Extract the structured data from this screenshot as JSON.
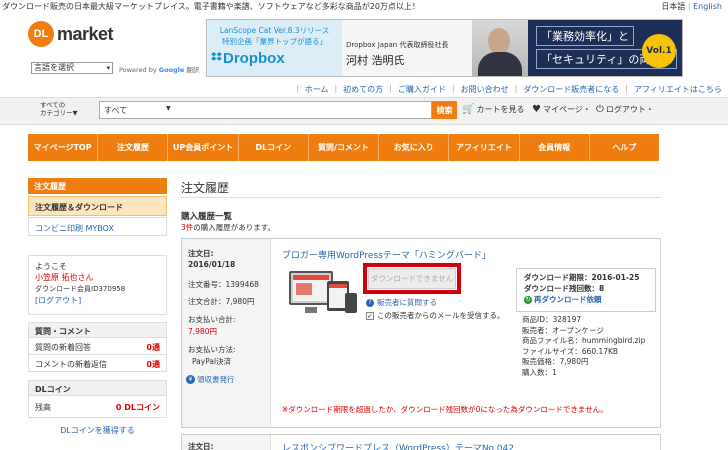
{
  "header": {
    "tagline": "ダウンロード販売の日本最大級マーケットプレイス。電子書籍や楽譜、ソフトウェアなど多彩な商品が20万点以上！",
    "lang_ja": "日本語",
    "lang_sep": "|",
    "lang_en": "English",
    "logo_mark": "DL",
    "logo_text": "market",
    "lang_select": "言語を選択",
    "powered_by": "Powered by",
    "google": "Google",
    "translate": "翻訳"
  },
  "banner": {
    "line1": "LanScope Cat Ver.8.3リリース",
    "line2": "特別企画「業界トップが語る」",
    "brand": "Dropbox",
    "company": "Dropbox Japan 代表取締役社長",
    "person": "河村 浩明氏",
    "headline1": "「業務効率化」と",
    "headline2": "「セキュリティ」の両立へ",
    "vol": "Vol.1"
  },
  "util_links": [
    "ホーム",
    "初めての方",
    "ご購入ガイド",
    "お問い合わせ",
    "ダウンロード販売者になる",
    "アフィリエイトはこちら"
  ],
  "search": {
    "category_label": "すべての\nカテゴリー▼",
    "value": "すべて",
    "button": "検索",
    "cart": "カートを見る",
    "mypage": "マイページ・",
    "logout": "ログアウト・"
  },
  "nav": [
    "マイページTOP",
    "注文履歴",
    "UP会員ポイント",
    "DLコイン",
    "質問/コメント",
    "お気に入り",
    "アフィリエイト",
    "会員情報",
    "ヘルプ"
  ],
  "sidebar": {
    "section_order": "注文履歴",
    "item_history": "注文履歴＆ダウンロード",
    "item_print": "コンビニ印刷 MYBOX",
    "welcome": "ようこそ",
    "user_name": "小笠原 拓也さん",
    "member_id_label": "ダウンロード会員ID",
    "member_id": "370958",
    "logout": "[ログアウト]",
    "qa_title": "質問・コメント",
    "qa_new_answer": "質問の新着回答",
    "qa_new_answer_count": "0通",
    "qa_new_reply": "コメントの新着返信",
    "qa_new_reply_count": "0通",
    "coin_title": "DLコイン",
    "coin_balance_label": "残高",
    "coin_balance": "0 DLコイン",
    "coin_link": "DLコインを獲得する"
  },
  "main": {
    "title": "注文履歴",
    "list_title": "購入履歴一覧",
    "list_count": "3件",
    "list_count_suffix": "の購入履歴があります。",
    "order": {
      "date_label": "注文日:",
      "date": "2016/01/18",
      "number": "注文番号：1399468",
      "total": "注文合計：7,980円",
      "paid_label": "お支払い合計:",
      "paid": "7,980円",
      "method_label": "お支払い方法:",
      "method": "PayPal決済",
      "receipt": "領収書発行",
      "product_title": "ブロガー専用WordPressテーマ「ハミングバード」",
      "download_btn": "ダウンロードできません",
      "ask_seller": "販売者に質問する",
      "mail_opt": "この販売者からのメールを受信する。",
      "dl_deadline": "ダウンロード期限：2016-01-25",
      "dl_remaining": "ダウンロード残回数：8",
      "redownload": "再ダウンロード依頼",
      "product_id": "商品ID：328197",
      "seller": "販売者：オープンケージ",
      "filename": "商品ファイル名：hummingbird.zip",
      "filesize": "ファイルサイズ：660.17KB",
      "price": "販売価格：7,980円",
      "qty": "購入数：1",
      "warning": "※ダウンロード期限を超過したか、ダウンロード残回数が0になった為ダウンロードできません。"
    },
    "order2": {
      "date_label": "注文日:",
      "product_title": "レスポンシブワードプレス（WordPress）テーマNo.042"
    }
  },
  "colors": {
    "accent": "#f07d10",
    "link": "#2a66b0",
    "alert": "#d00000"
  }
}
